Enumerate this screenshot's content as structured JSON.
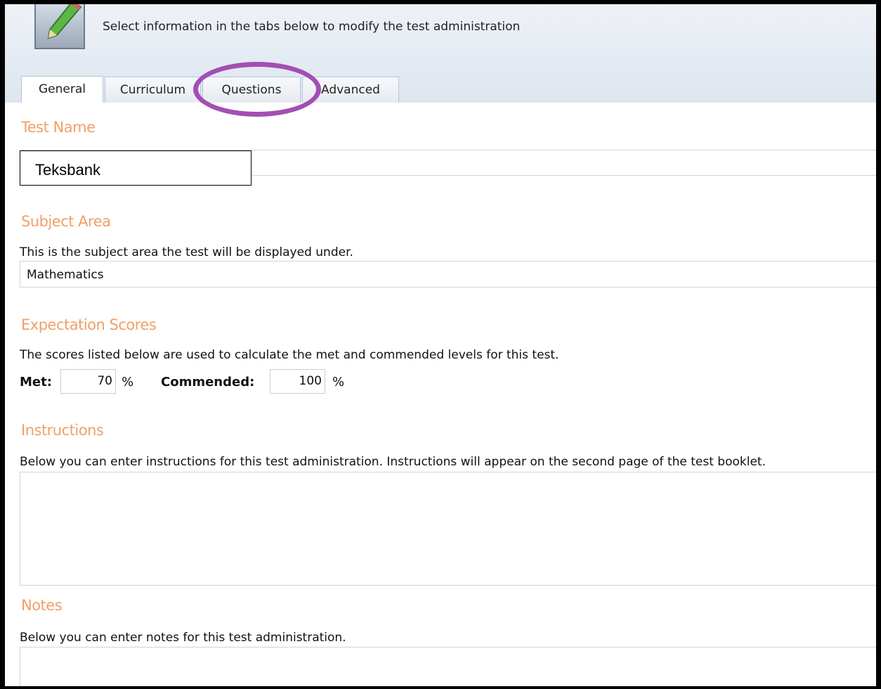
{
  "header": {
    "text": "Select information in the tabs below to modify the test administration"
  },
  "tabs": [
    {
      "label": "General",
      "active": true
    },
    {
      "label": "Curriculum",
      "active": false
    },
    {
      "label": "Questions",
      "active": false
    },
    {
      "label": "Advanced",
      "active": false
    }
  ],
  "test_name": {
    "title": "Test Name",
    "value": "Teksbank"
  },
  "subject_area": {
    "title": "Subject Area",
    "description": "This is the subject area the test will be displayed under.",
    "value": "Mathematics"
  },
  "expectation_scores": {
    "title": "Expectation Scores",
    "description": "The scores listed below are used to calculate the met and commended levels for this test.",
    "met_label": "Met:",
    "met_value": "70",
    "commended_label": "Commended:",
    "commended_value": "100",
    "percent_symbol": "%"
  },
  "instructions": {
    "title": "Instructions",
    "description": "Below you can enter instructions for this test administration. Instructions will appear on the second page of the test booklet.",
    "value": ""
  },
  "notes": {
    "title": "Notes",
    "description": "Below you can enter notes for this test administration.",
    "value": ""
  },
  "colors": {
    "section_title": "#f0a068",
    "annotation_circle": "#a24fb3"
  }
}
